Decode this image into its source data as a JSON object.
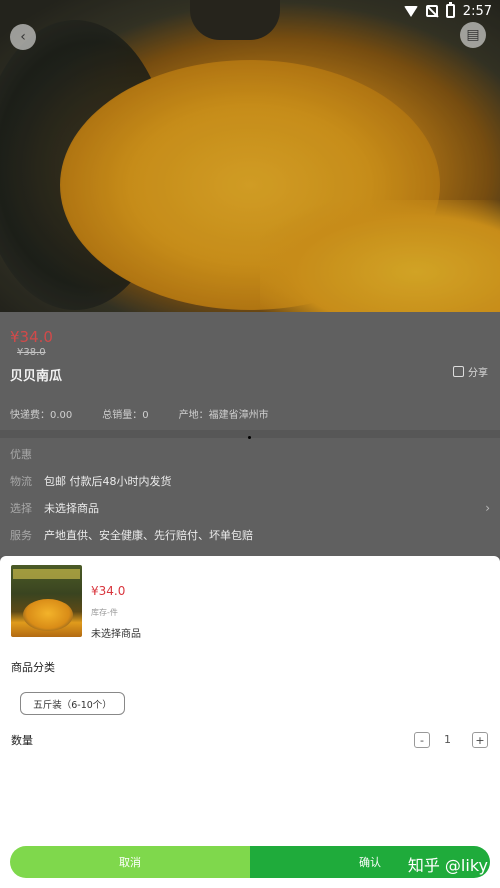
{
  "status_bar": {
    "time": "2:57"
  },
  "product": {
    "price": "¥34.0",
    "original_price": "¥38.0",
    "name": "贝贝南瓜",
    "share_label": "分享",
    "shipping_fee": "快递费：0.00",
    "total_sales": "总销量：0",
    "origin": "产地：福建省漳州市"
  },
  "info_rows": [
    {
      "label": "优惠",
      "value": ""
    },
    {
      "label": "物流",
      "value": "包邮 付款后48小时内发货"
    },
    {
      "label": "选择",
      "value": "未选择商品"
    },
    {
      "label": "服务",
      "value": "产地直供、安全健康、先行赔付、坏单包赔"
    }
  ],
  "sheet": {
    "price": "¥34.0",
    "stock": "库存-件",
    "selection": "未选择商品",
    "category_label": "商品分类",
    "option": "五斤装（6-10个）",
    "quantity_label": "数量",
    "quantity": "1",
    "minus": "-",
    "plus": "+",
    "cancel": "取消",
    "confirm": "确认"
  },
  "watermark": "知乎 @liky",
  "icons": {
    "back": "chevron-left-icon",
    "cart": "cart-icon",
    "share": "share-icon",
    "row_chevron": "chevron-right-icon"
  },
  "colors": {
    "price_red": "#d9363e",
    "cancel_green": "#7fd84c",
    "confirm_green": "#1fab3b"
  }
}
